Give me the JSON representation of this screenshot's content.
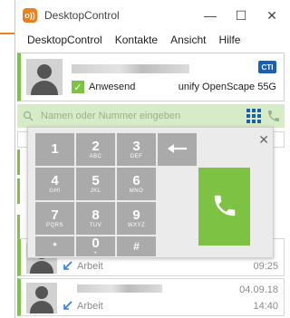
{
  "window": {
    "logo_text": "o))",
    "title": "DesktopControl",
    "minimize": "—",
    "maximize": "☐",
    "close": "✕"
  },
  "menu": {
    "items": [
      "DesktopControl",
      "Kontakte",
      "Ansicht",
      "Hilfe"
    ]
  },
  "contact": {
    "badge": "CTI",
    "status": "Anwesend",
    "device": "unify OpenScape 55G"
  },
  "search": {
    "placeholder": "Namen oder Nummer eingeben"
  },
  "dialpad": {
    "close": "✕",
    "keys": [
      {
        "digit": "1",
        "letters": ""
      },
      {
        "digit": "2",
        "letters": "ABC"
      },
      {
        "digit": "3",
        "letters": "DEF"
      },
      {
        "digit": "4",
        "letters": "GHI"
      },
      {
        "digit": "5",
        "letters": "JKL"
      },
      {
        "digit": "6",
        "letters": "MNO"
      },
      {
        "digit": "7",
        "letters": "PQRS"
      },
      {
        "digit": "8",
        "letters": "TUV"
      },
      {
        "digit": "9",
        "letters": "WXYZ"
      },
      {
        "digit": "*",
        "letters": ""
      },
      {
        "digit": "0",
        "letters": "+"
      },
      {
        "digit": "#",
        "letters": ""
      }
    ]
  },
  "history": [
    {
      "label": "Arbeit",
      "date": "",
      "time": "09:25"
    },
    {
      "label": "Arbeit",
      "date": "04.09.18",
      "time": "14:40"
    }
  ],
  "colors": {
    "accent_orange": "#e8821e",
    "presence_green": "#7dc242",
    "key_gray": "#aaaaaa",
    "cti_blue": "#1a5fb4"
  }
}
